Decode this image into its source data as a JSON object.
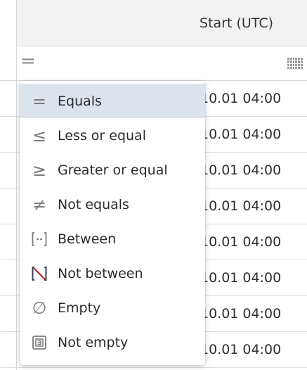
{
  "column": {
    "header_title": "Start (UTC)",
    "filter_operator_symbol": "="
  },
  "rows": [
    {
      "start": "10.01 04:00"
    },
    {
      "start": "10.01 04:00"
    },
    {
      "start": "10.01 04:00"
    },
    {
      "start": "10.01 04:00"
    },
    {
      "start": "10.01 04:00"
    },
    {
      "start": "10.01 04:00"
    },
    {
      "start": "10.01 04:00"
    },
    {
      "start": "10.01 04:00"
    }
  ],
  "filter_menu": {
    "selected_index": 0,
    "items": [
      {
        "label": "Equals",
        "icon": "equals-icon",
        "symbol": "="
      },
      {
        "label": "Less or equal",
        "icon": "less-or-equal-icon",
        "symbol": "≤"
      },
      {
        "label": "Greater or equal",
        "icon": "greater-or-equal-icon",
        "symbol": "≥"
      },
      {
        "label": "Not equals",
        "icon": "not-equals-icon",
        "symbol": "≠"
      },
      {
        "label": "Between",
        "icon": "between-icon",
        "symbol": "[··]"
      },
      {
        "label": "Not between",
        "icon": "not-between-icon",
        "symbol": ""
      },
      {
        "label": "Empty",
        "icon": "empty-icon",
        "symbol": "∅"
      },
      {
        "label": "Not empty",
        "icon": "not-empty-icon",
        "symbol": ""
      }
    ]
  },
  "colors": {
    "selected_item_bg": "#dde3ec",
    "header_bg": "#f2f2f2",
    "icon_gray": "#7c7c7c",
    "not_between_accent": "#b52a2a",
    "not_between_dark": "#3a3f5c"
  }
}
